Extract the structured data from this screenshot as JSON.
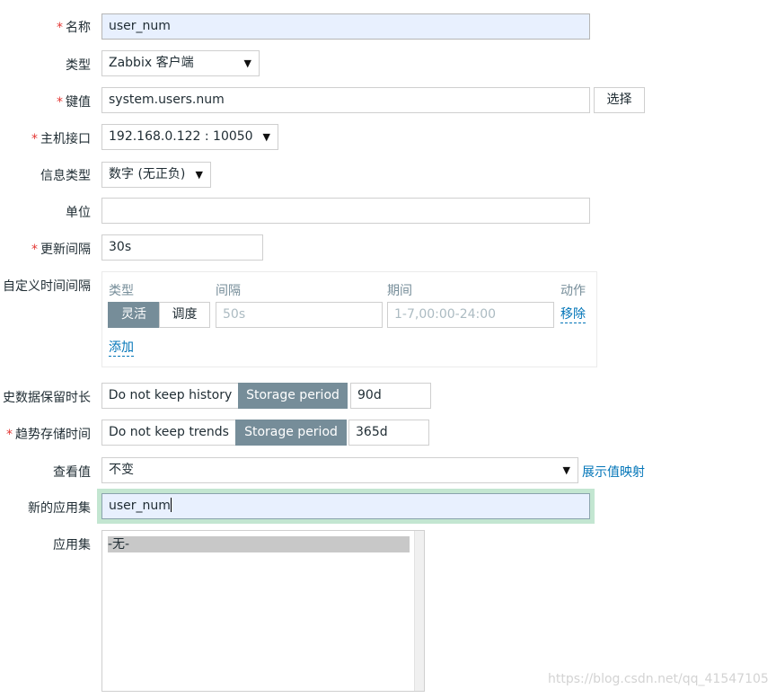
{
  "form": {
    "name": {
      "label": "名称",
      "value": "user_num"
    },
    "type": {
      "label": "类型",
      "value": "Zabbix 客户端"
    },
    "key": {
      "label": "键值",
      "value": "system.users.num",
      "select_button": "选择"
    },
    "host_interface": {
      "label": "主机接口",
      "value": "192.168.0.122 : 10050"
    },
    "info_type": {
      "label": "信息类型",
      "value": "数字 (无正负)"
    },
    "units": {
      "label": "单位",
      "value": ""
    },
    "update_interval": {
      "label": "更新间隔",
      "value": "30s"
    },
    "custom_intervals": {
      "label": "自定义时间间隔",
      "headers": {
        "type": "类型",
        "interval": "间隔",
        "period": "期间",
        "action": "动作"
      },
      "row": {
        "type_options": [
          "灵活",
          "调度"
        ],
        "interval_placeholder": "50s",
        "period_placeholder": "1-7,00:00-24:00",
        "remove_label": "移除"
      },
      "add_label": "添加"
    },
    "history": {
      "label": "史数据保留时长",
      "options": [
        "Do not keep history",
        "Storage period"
      ],
      "value": "90d"
    },
    "trends": {
      "label": "趋势存储时间",
      "options": [
        "Do not keep trends",
        "Storage period"
      ],
      "value": "365d"
    },
    "show_value": {
      "label": "查看值",
      "value": "不变",
      "mapping_link": "展示值映射"
    },
    "new_application": {
      "label": "新的应用集",
      "value": "user_num"
    },
    "applications": {
      "label": "应用集",
      "items": [
        "-无-"
      ]
    }
  },
  "watermark": "https://blog.csdn.net/qq_41547105",
  "colors": {
    "required": "#e33734",
    "segment_active": "#768d99",
    "link": "#0275b8",
    "focus_glow": "#c3e6d1",
    "autofill": "#e8f0fe"
  }
}
